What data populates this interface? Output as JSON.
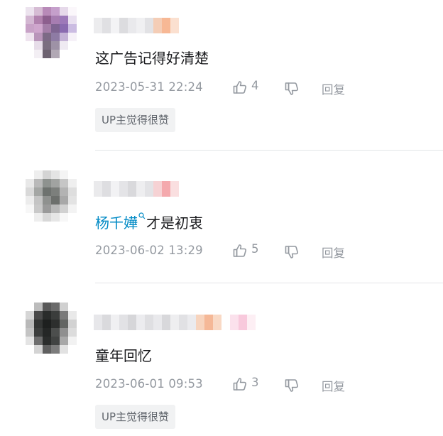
{
  "comments": [
    {
      "avatar": "blurred-avatar-purple",
      "username": "",
      "text": "这广告记得好清楚",
      "mention": "",
      "time": "2023-05-31 22:24",
      "likes": "4",
      "reply_label": "回复",
      "badge": "UP主觉得很赞"
    },
    {
      "avatar": "blurred-avatar-gray",
      "username": "",
      "mention": "杨千嬅",
      "text": "才是初衷",
      "time": "2023-06-02 13:29",
      "likes": "5",
      "reply_label": "回复",
      "badge": ""
    },
    {
      "avatar": "blurred-avatar-dark",
      "username": "",
      "text": "童年回忆",
      "mention": "",
      "time": "2023-06-01 09:53",
      "likes": "3",
      "reply_label": "回复",
      "badge": "UP主觉得很赞"
    }
  ],
  "colors": {
    "mention": "#008ac5",
    "meta_text": "#9499a0",
    "badge_bg": "#f1f2f3",
    "divider": "#e3e5e7"
  }
}
